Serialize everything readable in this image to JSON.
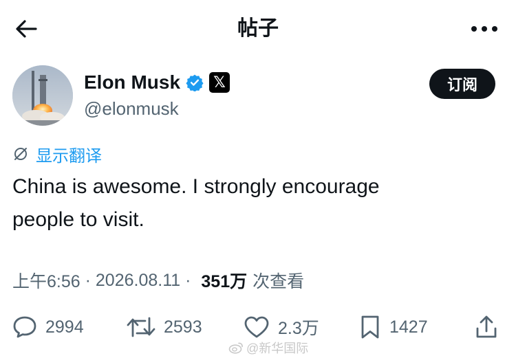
{
  "header": {
    "title": "帖子",
    "back_icon": "arrow-left-icon",
    "more_icon": "more-horizontal-icon"
  },
  "author": {
    "name": "Elon Musk",
    "handle": "@elonmusk",
    "verified_color": "#1d9bf0",
    "avatar_icon": "rocket-launch-avatar",
    "x_badge": "𝕏"
  },
  "subscribe_label": "订阅",
  "translate_label": "显示翻译",
  "post": {
    "text": "China is awesome. I strongly encourage people to visit."
  },
  "meta": {
    "time": "上午6:56",
    "sep1": " · ",
    "date": "2026.08.11",
    "sep2": " · ",
    "views_count": "351万",
    "views_label": "次查看"
  },
  "actions": {
    "replies": "2994",
    "reposts": "2593",
    "likes": "2.3万",
    "bookmarks": "1427"
  },
  "watermark": "@新华国际",
  "colors": {
    "accent": "#1d9bf0",
    "text": "#0f1419",
    "secondary": "#536471"
  }
}
